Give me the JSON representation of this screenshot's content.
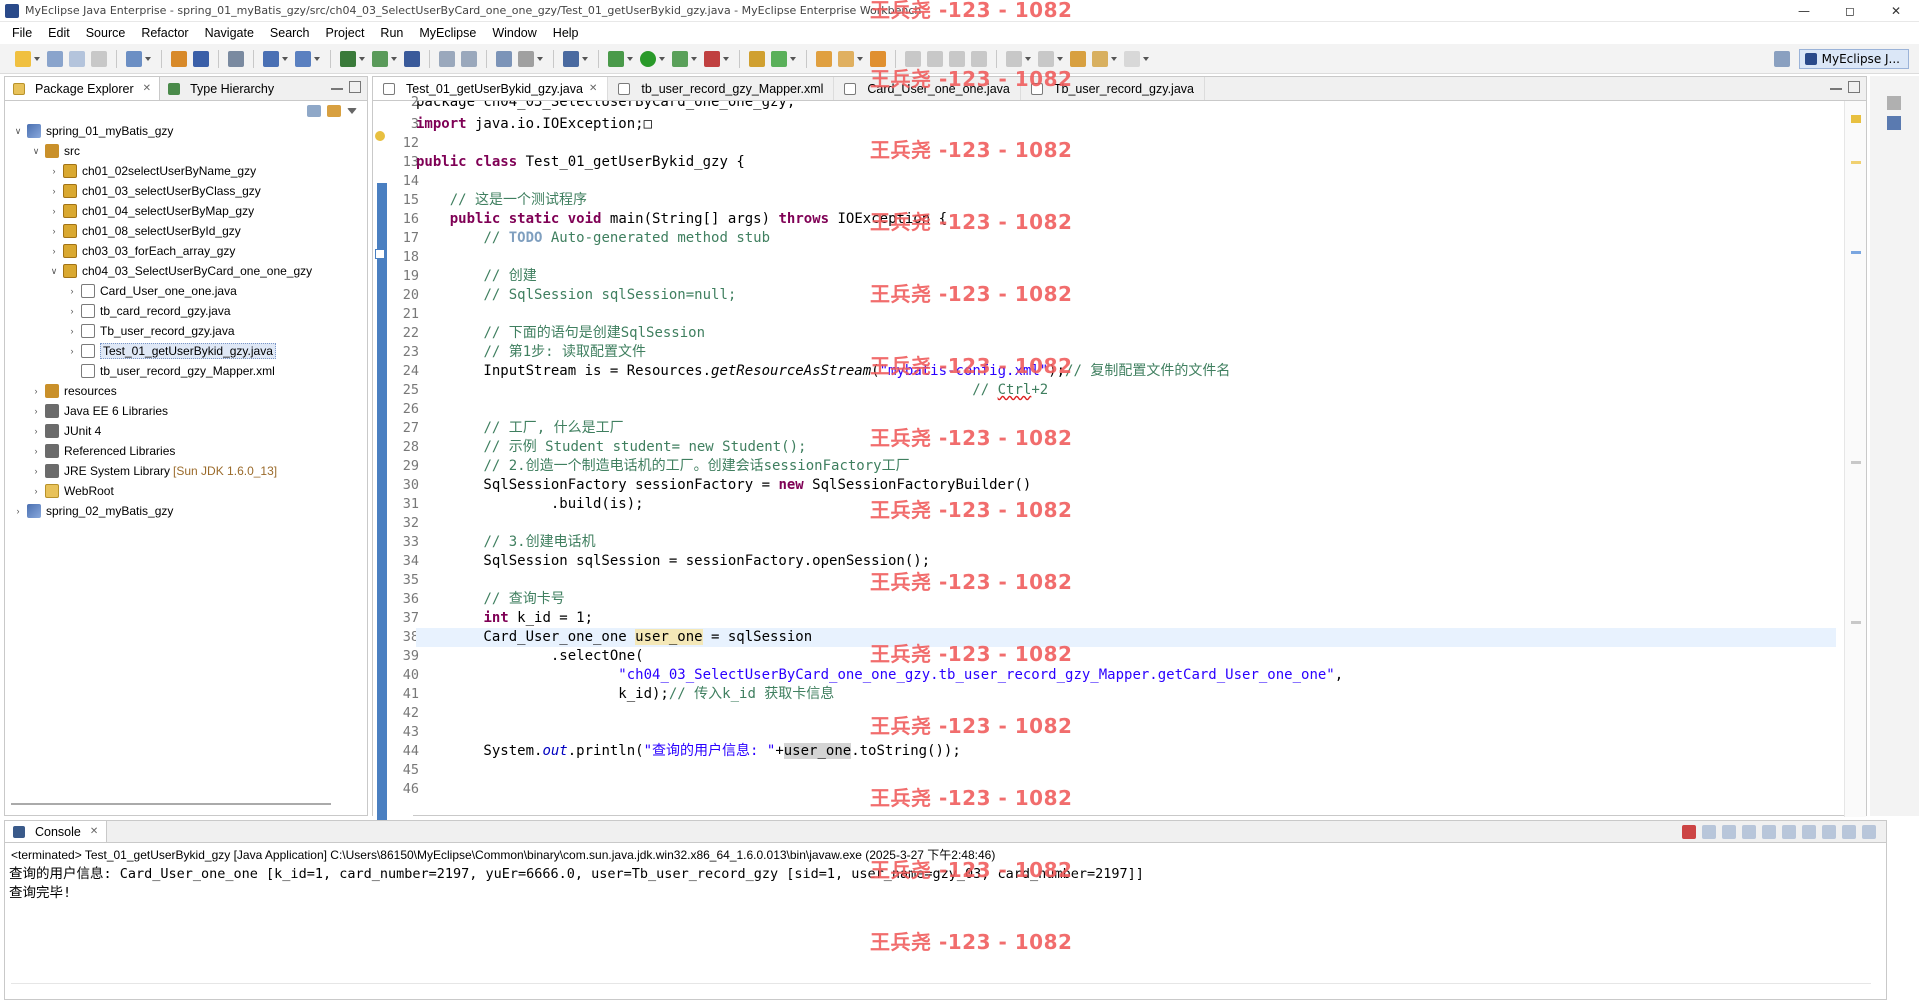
{
  "window": {
    "title": "MyEclipse Java Enterprise - spring_01_myBatis_gzy/src/ch04_03_SelectUserByCard_one_one_gzy/Test_01_getUserBykid_gzy.java - MyEclipse Enterprise Workbench"
  },
  "menu": [
    "File",
    "Edit",
    "Source",
    "Refactor",
    "Navigate",
    "Search",
    "Project",
    "Run",
    "MyEclipse",
    "Window",
    "Help"
  ],
  "perspective": {
    "label": "MyEclipse J..."
  },
  "explorer": {
    "tabs": [
      "Package Explorer",
      "Type Hierarchy"
    ],
    "items": [
      {
        "label": "spring_01_myBatis_gzy",
        "indent": 0,
        "twisty": "v",
        "icon": "project"
      },
      {
        "label": "src",
        "indent": 1,
        "twisty": "v",
        "icon": "source-folder"
      },
      {
        "label": "ch01_02selectUserByName_gzy",
        "indent": 2,
        "twisty": ">",
        "icon": "package"
      },
      {
        "label": "ch01_03_selectUserByClass_gzy",
        "indent": 2,
        "twisty": ">",
        "icon": "package"
      },
      {
        "label": "ch01_04_selectUserByMap_gzy",
        "indent": 2,
        "twisty": ">",
        "icon": "package"
      },
      {
        "label": "ch01_08_selectUserById_gzy",
        "indent": 2,
        "twisty": ">",
        "icon": "package"
      },
      {
        "label": "ch03_03_forEach_array_gzy",
        "indent": 2,
        "twisty": ">",
        "icon": "package"
      },
      {
        "label": "ch04_03_SelectUserByCard_one_one_gzy",
        "indent": 2,
        "twisty": "v",
        "icon": "package"
      },
      {
        "label": "Card_User_one_one.java",
        "indent": 3,
        "twisty": ">",
        "icon": "java"
      },
      {
        "label": "tb_card_record_gzy.java",
        "indent": 3,
        "twisty": ">",
        "icon": "java"
      },
      {
        "label": "Tb_user_record_gzy.java",
        "indent": 3,
        "twisty": ">",
        "icon": "java"
      },
      {
        "label": "Test_01_getUserBykid_gzy.java",
        "indent": 3,
        "twisty": ">",
        "icon": "java",
        "selected": true
      },
      {
        "label": "tb_user_record_gzy_Mapper.xml",
        "indent": 3,
        "twisty": "",
        "icon": "xml"
      },
      {
        "label": "resources",
        "indent": 1,
        "twisty": ">",
        "icon": "source-folder"
      },
      {
        "label": "Java EE 6 Libraries",
        "indent": 1,
        "twisty": ">",
        "icon": "library"
      },
      {
        "label": "JUnit 4",
        "indent": 1,
        "twisty": ">",
        "icon": "library"
      },
      {
        "label": "Referenced Libraries",
        "indent": 1,
        "twisty": ">",
        "icon": "library"
      },
      {
        "label": "JRE System Library",
        "extra": "[Sun JDK 1.6.0_13]",
        "indent": 1,
        "twisty": ">",
        "icon": "library"
      },
      {
        "label": "WebRoot",
        "indent": 1,
        "twisty": ">",
        "icon": "folder"
      },
      {
        "label": "spring_02_myBatis_gzy",
        "indent": 0,
        "twisty": ">",
        "icon": "project"
      }
    ]
  },
  "editor": {
    "tabs": [
      "Test_01_getUserBykid_gzy.java",
      "tb_user_record_gzy_Mapper.xml",
      "Card_User_one_one.java",
      "Tb_user_record_gzy.java"
    ],
    "line_numbers": [
      "2",
      "3",
      "12",
      "13",
      "14",
      "15",
      "16",
      "17",
      "18",
      "19",
      "20",
      "21",
      "22",
      "23",
      "24",
      "25",
      "26",
      "27",
      "28",
      "29",
      "30",
      "31",
      "32",
      "33",
      "34",
      "35",
      "36",
      "37",
      "38",
      "39",
      "40",
      "41",
      "42",
      "43",
      "44",
      "45",
      "46"
    ],
    "current_line": "38"
  },
  "watermark": {
    "text": "王兵尧 -123 - 1082"
  },
  "console": {
    "tab": "Console",
    "header": "<terminated> Test_01_getUserBykid_gzy [Java Application] C:\\Users\\86150\\MyEclipse\\Common\\binary\\com.sun.java.jdk.win32.x86_64_1.6.0.013\\bin\\javaw.exe (2025-3-27 下午2:48:46)",
    "output": [
      "查询的用户信息: Card_User_one_one [k_id=1, card_number=2197, yuEr=6666.0, user=Tb_user_record_gzy [sid=1, user_name=gzy_03, card_number=2197]]",
      "查询完毕!"
    ]
  },
  "colors": {
    "keyword": "#7f0055",
    "comment": "#3f7f5f",
    "string": "#2a00ff",
    "current_line": "#e8f2fe",
    "watermark": "#f05a5a"
  }
}
